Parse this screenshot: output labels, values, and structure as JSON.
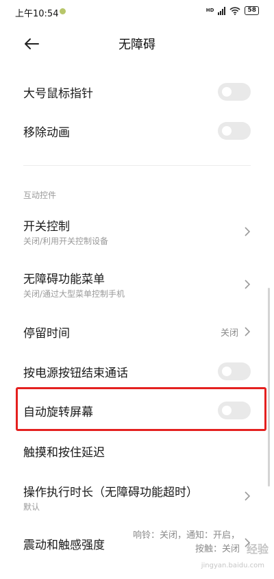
{
  "status_bar": {
    "time": "上午10:54",
    "network_label": "HD",
    "battery": "58"
  },
  "header": {
    "title": "无障碍"
  },
  "rows": {
    "large_pointer": {
      "title": "大号鼠标指针",
      "toggle_on": false
    },
    "remove_animation": {
      "title": "移除动画",
      "toggle_on": false
    },
    "interaction_section": "互动控件",
    "switch_access": {
      "title": "开关控制",
      "subtitle": "关闭/利用开关控制设备"
    },
    "accessibility_menu": {
      "title": "无障碍功能菜单",
      "subtitle": "关闭/通过大型菜单控制手机"
    },
    "dwell_time": {
      "title": "停留时间",
      "value": "关闭"
    },
    "power_ends_call": {
      "title": "按电源按钮结束通话",
      "toggle_on": false
    },
    "auto_rotate": {
      "title": "自动旋转屏幕",
      "toggle_on": false
    },
    "touch_hold_delay": {
      "title": "触摸和按住延迟"
    },
    "action_timeout": {
      "title": "操作执行时长（无障碍功能超时）",
      "subtitle": "默认"
    },
    "vibration": {
      "title": "震动和触感强度",
      "value_line1": "响铃：关闭，通知：开启，",
      "value_line2": "按触：关闭"
    }
  },
  "watermark": {
    "text": "经验",
    "url": "jingyan.baidu.com"
  },
  "colors": {
    "highlight": "#e4201f",
    "toggle_off": "#e9e9e9"
  }
}
